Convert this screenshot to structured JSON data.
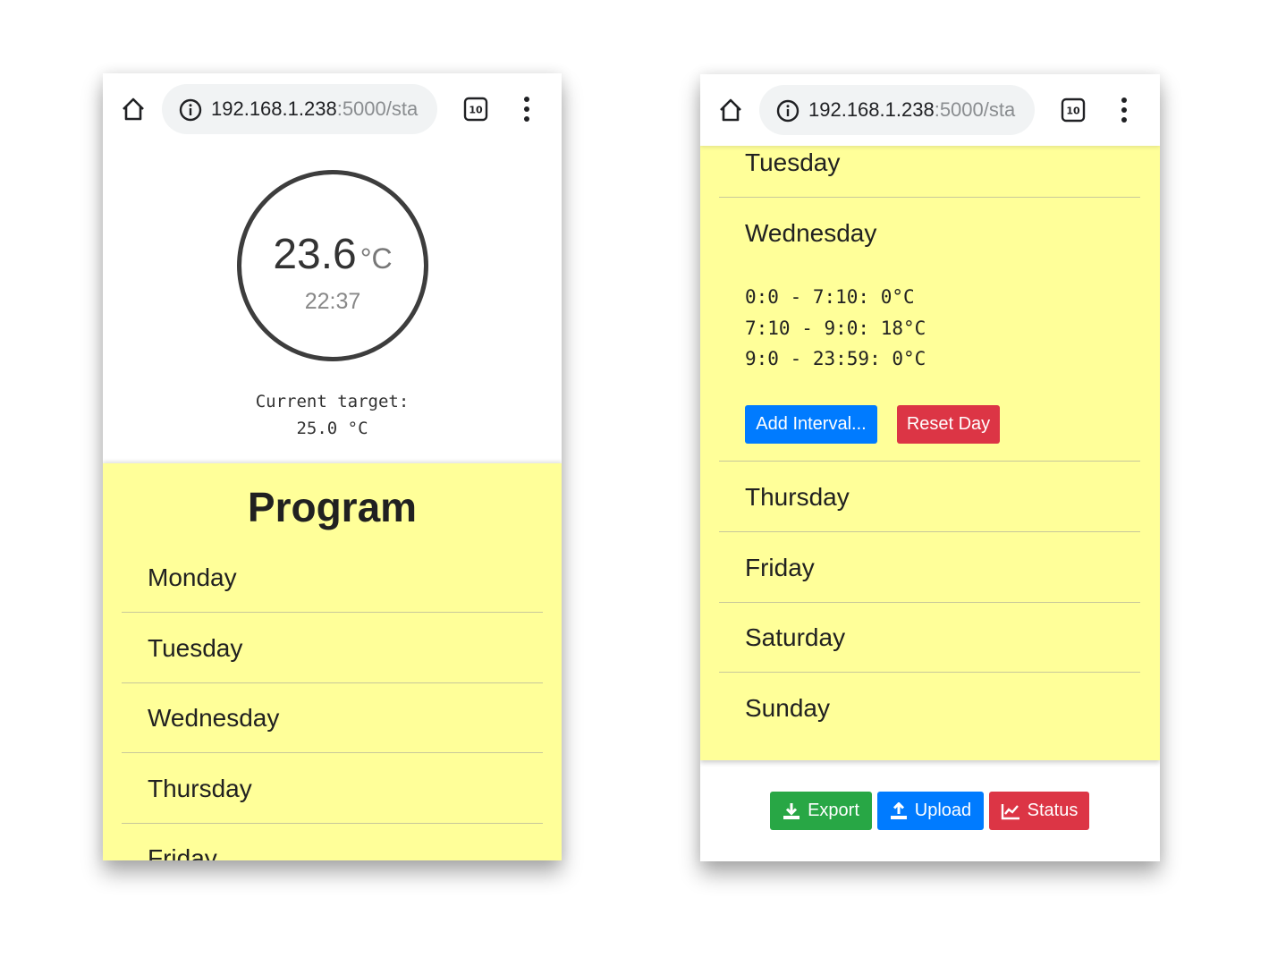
{
  "browser": {
    "url_host": "192.168.1.238",
    "url_rest": ":5000/sta",
    "tab_count": "10"
  },
  "status": {
    "temperature": "23.6",
    "unit": "°C",
    "time": "22:37",
    "target_label": "Current target:",
    "target_value": "25.0 °C"
  },
  "program": {
    "title": "Program",
    "days": [
      "Monday",
      "Tuesday",
      "Wednesday",
      "Thursday",
      "Friday",
      "Saturday",
      "Sunday"
    ]
  },
  "wednesday_detail": {
    "intervals": [
      "0:0 - 7:10: 0°C",
      "7:10 - 9:0: 18°C",
      "9:0 - 23:59: 0°C"
    ],
    "add_interval_label": "Add Interval...",
    "reset_day_label": "Reset Day"
  },
  "footer": {
    "export_label": "Export",
    "upload_label": "Upload",
    "status_label": "Status"
  },
  "colors": {
    "program_background": "#ffff99",
    "primary": "#007bff",
    "danger": "#dc3545",
    "success": "#28a745"
  },
  "icons": [
    "home-icon",
    "info-icon",
    "tabs-icon",
    "menu-icon",
    "download-icon",
    "upload-icon",
    "chart-icon"
  ]
}
